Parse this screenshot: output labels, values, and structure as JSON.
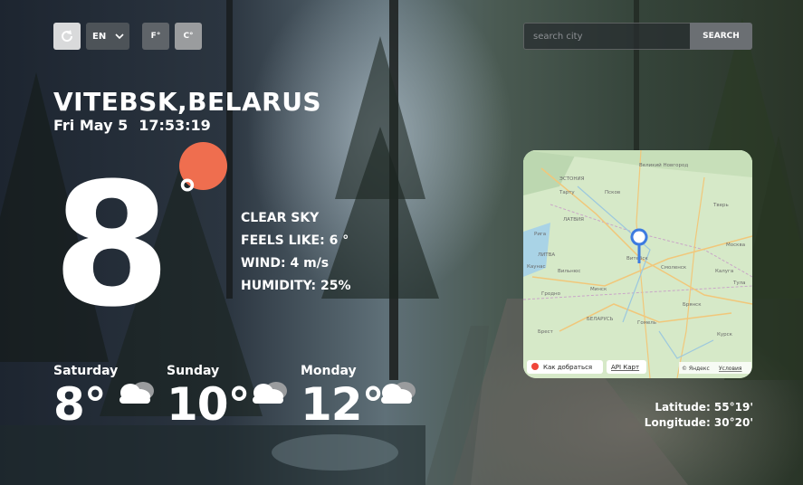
{
  "controls": {
    "language": "EN",
    "unit_f": "F°",
    "unit_c": "C°"
  },
  "search": {
    "placeholder": "search city",
    "button": "SEARCH"
  },
  "location": {
    "city": "VITEBSK,BELARUS",
    "day": "Fri May 5",
    "time": "17:53:19"
  },
  "current": {
    "temp": "8",
    "condition": "CLEAR SKY",
    "feels_like": "FEELS LIKE: 6 °",
    "wind": "WIND: 4 m/s",
    "humidity": "HUMIDITY: 25%"
  },
  "forecast": [
    {
      "day": "Saturday",
      "temp": "8°",
      "icon": "cloud-icon"
    },
    {
      "day": "Sunday",
      "temp": "10°",
      "icon": "cloud-icon"
    },
    {
      "day": "Monday",
      "temp": "12°",
      "icon": "cloud-icon"
    }
  ],
  "map": {
    "directions_link": "Как добраться",
    "api_link": "API Карт",
    "copyright": "© Яндекс",
    "terms_link": "Условия",
    "labels": [
      "ЭСТОНИЯ",
      "Великий Новгород",
      "Тарту",
      "Псков",
      "ЛАТВИЯ",
      "Рига",
      "Тверь",
      "ЛИТВА",
      "Витебск",
      "Смоленск",
      "Москва",
      "Каунас",
      "Вильнюс",
      "Минск",
      "Калуга",
      "Тула",
      "Гродно",
      "БЕЛАРУСЬ",
      "Брянск",
      "Гомель",
      "Брест",
      "Курск"
    ]
  },
  "coordinates": {
    "latitude": "Latitude: 55°19'",
    "longitude": "Longitude: 30°20'"
  },
  "colors": {
    "sun": "#ef6e4f"
  }
}
